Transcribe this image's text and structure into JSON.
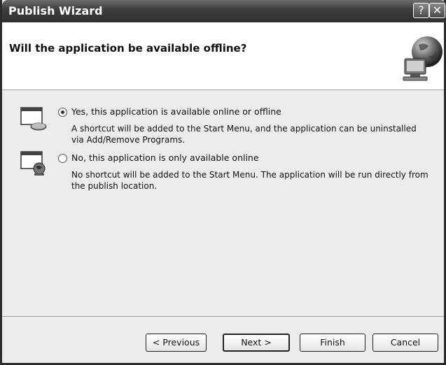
{
  "window": {
    "title": "Publish Wizard",
    "help_glyph": "?",
    "close_glyph": "✕"
  },
  "header": {
    "question": "Will the application be available offline?",
    "icon": "globe-computer-icon"
  },
  "options": [
    {
      "selected": true,
      "label": "Yes, this application is available online or offline",
      "description": "A shortcut will be added to the Start Menu, and the application can be uninstalled via Add/Remove Programs.",
      "icon": "computer-disk-icon"
    },
    {
      "selected": false,
      "label": "No, this application is only available online",
      "description": "No shortcut will be added to the Start Menu. The application will be run directly from the publish location.",
      "icon": "computer-globe-icon"
    }
  ],
  "buttons": {
    "previous": "< Previous",
    "next": "Next >",
    "finish": "Finish",
    "cancel": "Cancel"
  }
}
